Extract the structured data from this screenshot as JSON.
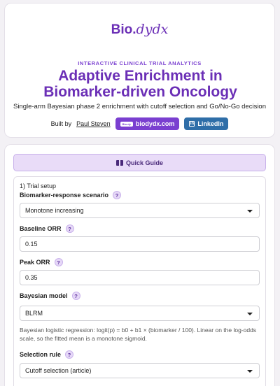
{
  "header": {
    "logo_prefix": "Bio.",
    "logo_suffix": "dydx",
    "eyebrow": "INTERACTIVE CLINICAL TRIAL ANALYTICS",
    "title": "Adaptive Enrichment in Biomarker-driven Oncology",
    "subtitle": "Single-arm Bayesian phase 2 enrichment with cutoff selection and Go/No-Go decision",
    "built_by": "Built by",
    "author": "Paul Steven",
    "site_button": "biodydx.com",
    "site_mini_logo": "Bio.dy",
    "linkedin_button": "LinkedIn",
    "linkedin_icon": "in"
  },
  "guide": {
    "label": "Quick Guide",
    "icon": "book-icon"
  },
  "setup": {
    "title": "1) Trial setup",
    "help_glyph": "?",
    "scenario": {
      "label": "Biomarker-response scenario",
      "value": "Monotone increasing"
    },
    "baseline": {
      "label": "Baseline ORR",
      "value": "0.15"
    },
    "peak": {
      "label": "Peak ORR",
      "value": "0.35"
    },
    "model": {
      "label": "Bayesian model",
      "value": "BLRM",
      "description": "Bayesian logistic regression: logit(p) = b0 + b1 × (biomarker / 100). Linear on the log-odds scale, so the fitted mean is a monotone sigmoid."
    },
    "rule": {
      "label": "Selection rule",
      "value": "Cutoff selection (article)"
    }
  },
  "colors": {
    "accent": "#6b2fb6",
    "link_button": "#2f6ea8",
    "guide_bg": "#e9dcf8"
  }
}
